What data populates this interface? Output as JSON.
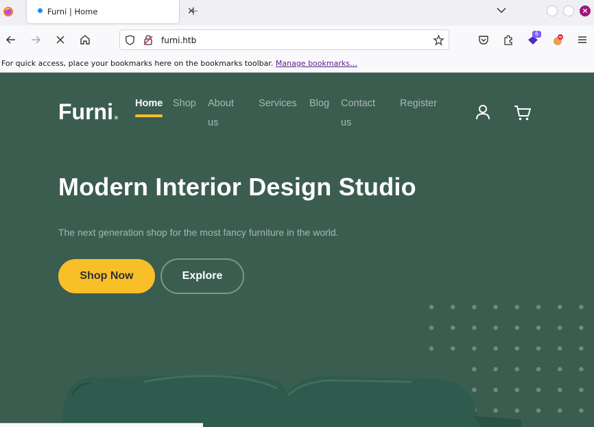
{
  "browser": {
    "tab_title": "Furni | Home",
    "tab_close": "×",
    "new_tab": "+",
    "url": "furni.htb",
    "extension_badge_count": "6",
    "window_close": "×",
    "bookmarks_hint": "For quick access, place your bookmarks here on the bookmarks toolbar.",
    "bookmarks_link": "Manage bookmarks…"
  },
  "site": {
    "logo": "Furni",
    "logo_dot": ".",
    "nav": {
      "home": "Home",
      "shop": "Shop",
      "about_line1": "About",
      "about_line2": "us",
      "services": "Services",
      "blog": "Blog",
      "contact_line1": "Contact",
      "contact_line2": "us",
      "register": "Register"
    },
    "hero": {
      "title": "Modern Interior Design Studio",
      "subtitle": "The next generation shop for the most fancy furniture in the world.",
      "primary_button": "Shop Now",
      "secondary_button": "Explore"
    }
  },
  "colors": {
    "page_bg": "#3b5d50",
    "accent_yellow": "#f9bf29",
    "sofa_green": "#2f5a4e"
  },
  "icons": [
    "firefox-icon",
    "back-icon",
    "forward-icon",
    "stop-icon",
    "home-icon",
    "shield-icon",
    "insecure-lock-icon",
    "bookmark-star-icon",
    "pocket-icon",
    "extensions-icon",
    "ublock-icon",
    "menu-icon",
    "user-icon",
    "cart-icon"
  ]
}
